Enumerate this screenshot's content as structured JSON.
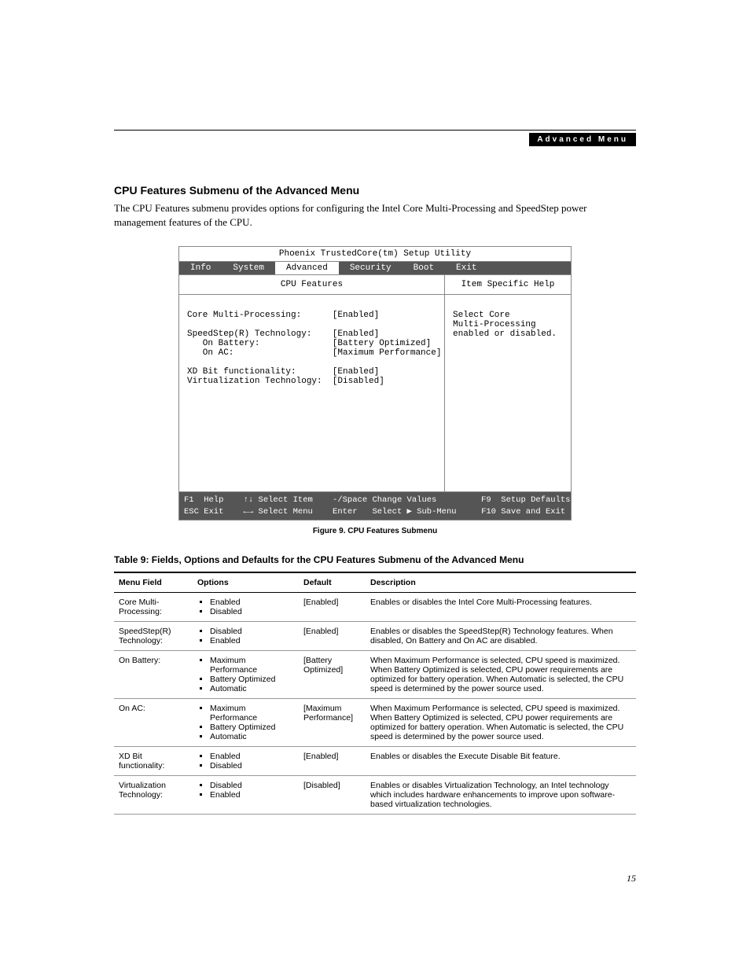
{
  "header": {
    "breadcrumb": "Advanced Menu"
  },
  "section": {
    "title": "CPU Features Submenu of the Advanced Menu",
    "intro": "The CPU Features submenu provides options for configuring the Intel Core Multi-Processing and SpeedStep power management features of the CPU."
  },
  "bios": {
    "title": "Phoenix TrustedCore(tm) Setup Utility",
    "tabs": [
      "Info",
      "System",
      "Advanced",
      "Security",
      "Boot",
      "Exit"
    ],
    "selected_tab": "Advanced",
    "left_heading": "CPU Features",
    "right_heading": "Item Specific Help",
    "rows": [
      {
        "label": "Core Multi-Processing:",
        "value": "[Enabled]",
        "indent": 0,
        "hl": true
      },
      {
        "label": "",
        "value": "",
        "indent": 0,
        "hl": false
      },
      {
        "label": "SpeedStep(R) Technology:",
        "value": "[Enabled]",
        "indent": 0,
        "hl": false
      },
      {
        "label": "On Battery:",
        "value": "[Battery Optimized]",
        "indent": 1,
        "hl": false
      },
      {
        "label": "On AC:",
        "value": "[Maximum Performance]",
        "indent": 1,
        "hl": false
      },
      {
        "label": "",
        "value": "",
        "indent": 0,
        "hl": false
      },
      {
        "label": "XD Bit functionality:",
        "value": "[Enabled]",
        "indent": 0,
        "hl": false
      },
      {
        "label": "Virtualization Technology:",
        "value": "[Disabled]",
        "indent": 0,
        "hl": false
      }
    ],
    "help_text": "Select Core\nMulti-Processing\nenabled or disabled.",
    "footer_lines": [
      [
        "F1",
        "Help",
        "↑↓ Select Item",
        "-/Space",
        "Change Values",
        "F9",
        "Setup Defaults"
      ],
      [
        "ESC",
        "Exit",
        "←→ Select Menu",
        "Enter",
        "Select ▶ Sub-Menu",
        "F10",
        "Save and Exit"
      ]
    ]
  },
  "figure_caption": "Figure 9.  CPU Features Submenu",
  "table_caption": "Table 9: Fields, Options and Defaults for the CPU Features Submenu of the Advanced Menu",
  "table": {
    "headers": [
      "Menu Field",
      "Options",
      "Default",
      "Description"
    ],
    "rows": [
      {
        "field": "Core Multi-Processing:",
        "sub": false,
        "options": [
          "Enabled",
          "Disabled"
        ],
        "default": "[Enabled]",
        "desc": "Enables or disables the Intel Core Multi-Processing features."
      },
      {
        "field": "SpeedStep(R) Technology:",
        "sub": false,
        "options": [
          "Disabled",
          "Enabled"
        ],
        "default": "[Enabled]",
        "desc": "Enables or disables the SpeedStep(R) Technology features. When disabled, On Battery and On AC are disabled."
      },
      {
        "field": "On Battery:",
        "sub": true,
        "options": [
          "Maximum Performance",
          "Battery Optimized",
          "Automatic"
        ],
        "default": "[Battery Optimized]",
        "desc": "When Maximum Performance is selected, CPU speed is maximized. When Battery Optimized is selected, CPU power requirements are optimized for battery operation. When Automatic is selected, the CPU speed is determined by the power source used."
      },
      {
        "field": "On AC:",
        "sub": true,
        "options": [
          "Maximum Performance",
          "Battery Optimized",
          "Automatic"
        ],
        "default": "[Maximum Performance]",
        "desc": "When Maximum Performance is selected, CPU speed is maximized. When Battery Optimized is selected, CPU power requirements are optimized for battery operation. When Automatic is selected, the CPU speed is determined by the power source used."
      },
      {
        "field": "XD Bit functionality:",
        "sub": false,
        "options": [
          "Enabled",
          "Disabled"
        ],
        "default": "[Enabled]",
        "desc": "Enables or disables the Execute Disable Bit feature."
      },
      {
        "field": "Virtualization Technology:",
        "sub": false,
        "options": [
          "Disabled",
          "Enabled"
        ],
        "default": "[Disabled]",
        "desc": "Enables or disables Virtualization Technology, an Intel technology which includes hardware enhancements to improve upon software-based virtualization technologies."
      }
    ]
  },
  "page_number": "15"
}
